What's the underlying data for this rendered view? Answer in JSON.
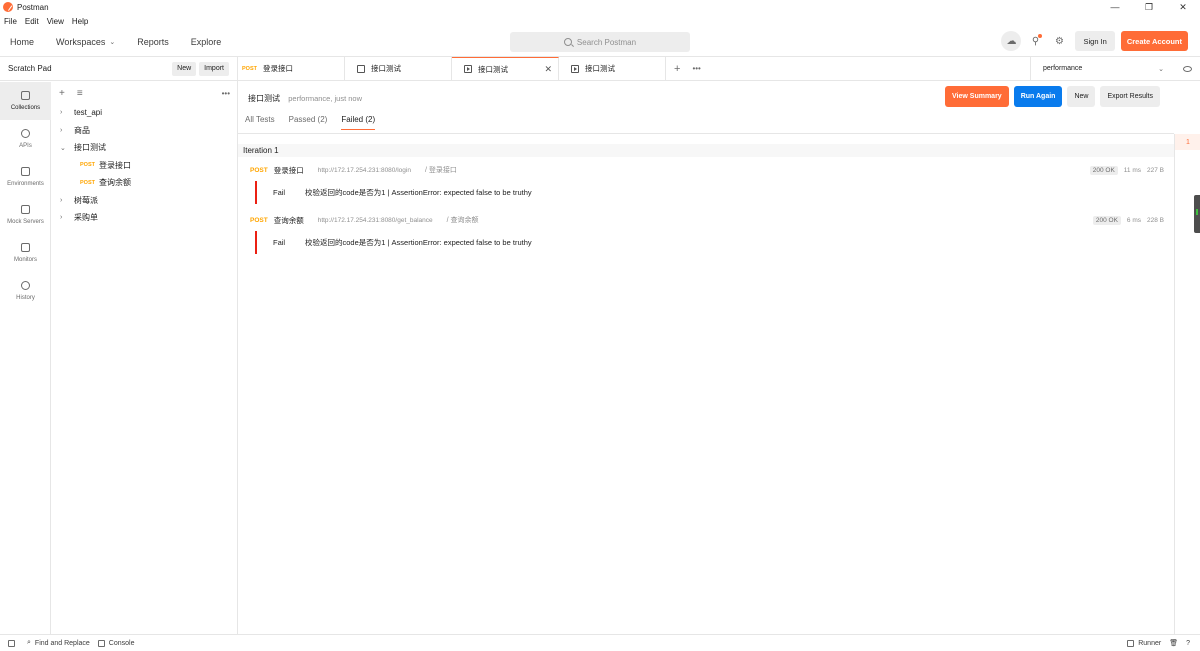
{
  "app": {
    "title": "Postman"
  },
  "menu": [
    "File",
    "Edit",
    "View",
    "Help"
  ],
  "header": {
    "nav": [
      {
        "label": "Home"
      },
      {
        "label": "Workspaces"
      },
      {
        "label": "Reports"
      },
      {
        "label": "Explore"
      }
    ],
    "search_placeholder": "Search Postman",
    "signin": "Sign In",
    "create": "Create Account"
  },
  "sidebar": {
    "title": "Scratch Pad",
    "new_btn": "New",
    "import_btn": "Import",
    "rail": [
      {
        "label": "Collections",
        "icon": "collections-icon"
      },
      {
        "label": "APIs",
        "icon": "apis-icon"
      },
      {
        "label": "Environments",
        "icon": "environments-icon"
      },
      {
        "label": "Mock Servers",
        "icon": "mock-servers-icon"
      },
      {
        "label": "Monitors",
        "icon": "monitors-icon"
      },
      {
        "label": "History",
        "icon": "history-icon"
      }
    ],
    "tree": [
      {
        "label": "test_api"
      },
      {
        "label": "商品"
      },
      {
        "label": "接口测试",
        "children": [
          {
            "method": "POST",
            "label": "登录接口"
          },
          {
            "method": "POST",
            "label": "查询余额"
          }
        ]
      },
      {
        "label": "树莓派"
      },
      {
        "label": "采购单"
      }
    ]
  },
  "tabs": [
    {
      "method": "POST",
      "label": "登录接口"
    },
    {
      "label": "接口测试"
    },
    {
      "label": "接口测试",
      "active": true
    },
    {
      "label": "接口测试"
    }
  ],
  "environment": {
    "selected": "performance"
  },
  "run": {
    "title": "接口测试",
    "meta": "performance, just now",
    "buttons": {
      "summary": "View Summary",
      "run_again": "Run Again",
      "new": "New",
      "export": "Export Results"
    },
    "filters": [
      "All Tests",
      "Passed (2)",
      "Failed (2)"
    ],
    "iteration": "Iteration 1",
    "requests": [
      {
        "method": "POST",
        "name": "登录接口",
        "url": "http://172.17.254.231:8080/login",
        "path": "/ 登录接口",
        "status": "200 OK",
        "time": "11 ms",
        "size": "227 B",
        "fail_label": "Fail",
        "fail_msg": "校验返回的code是否为1 | AssertionError: expected false to be truthy"
      },
      {
        "method": "POST",
        "name": "查询余额",
        "url": "http://172.17.254.231:8080/get_balance",
        "path": "/ 查询余额",
        "status": "200 OK",
        "time": "6 ms",
        "size": "228 B",
        "fail_label": "Fail",
        "fail_msg": "校验返回的code是否为1 | AssertionError: expected false to be truthy"
      }
    ],
    "minimap_num": "1"
  },
  "statusbar": {
    "find": "Find and Replace",
    "console": "Console",
    "runner": "Runner"
  },
  "colors": {
    "accent": "#ff6c37",
    "primary_blue": "#097bed",
    "fail_red": "#eb2013",
    "method_post": "#ffa500"
  }
}
